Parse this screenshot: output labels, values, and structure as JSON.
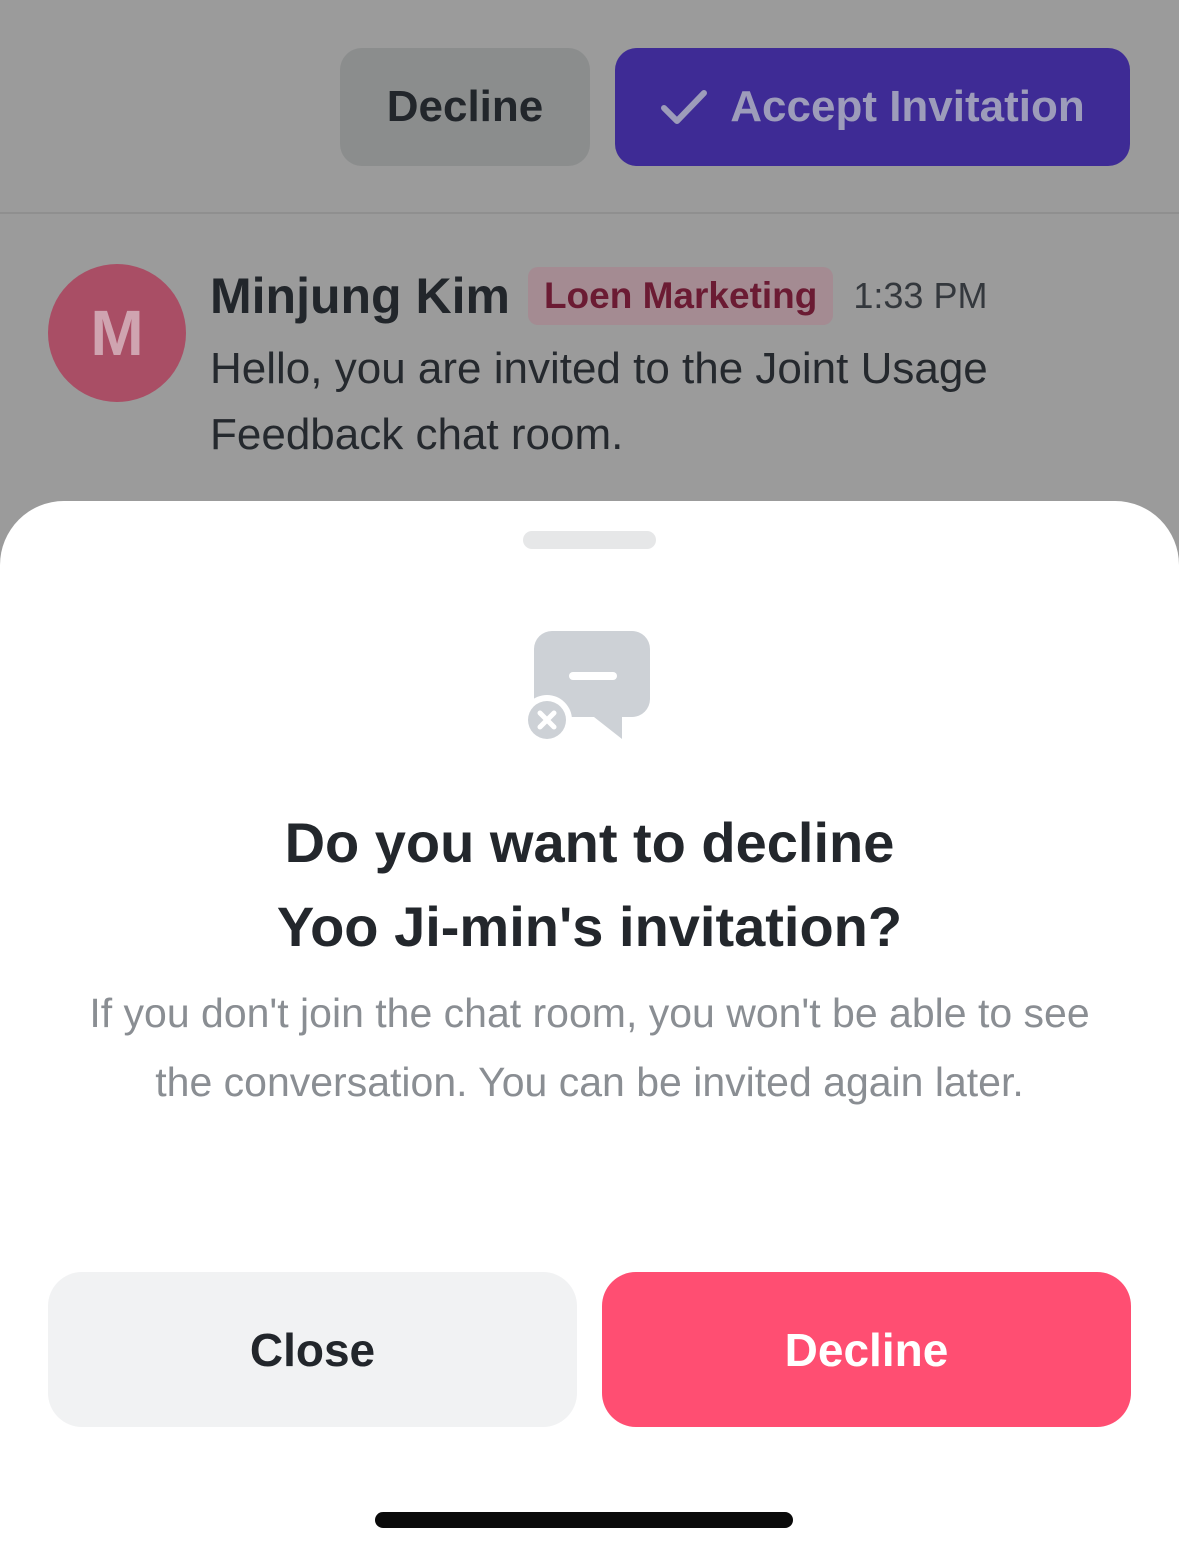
{
  "background": {
    "actions": {
      "decline_label": "Decline",
      "accept_label": "Accept Invitation",
      "accept_icon": "check-icon"
    },
    "message": {
      "avatar_initial": "M",
      "sender_name": "Minjung Kim",
      "org_badge": "Loen Marketing",
      "time": "1:33 PM",
      "text": "Hello, you are invited to the Joint Usage Feedback chat room."
    }
  },
  "sheet": {
    "icon": "chat-declined-icon",
    "title_line1": "Do you want to decline",
    "title_line2": "Yoo Ji-min's invitation?",
    "description": "If you don't join the chat room, you won't be able to see the conversation. You can be invited again later.",
    "close_label": "Close",
    "decline_label": "Decline"
  },
  "colors": {
    "accent_purple": "#3e2b95",
    "danger": "#ff4e72",
    "neutral_button": "#f1f2f3"
  }
}
